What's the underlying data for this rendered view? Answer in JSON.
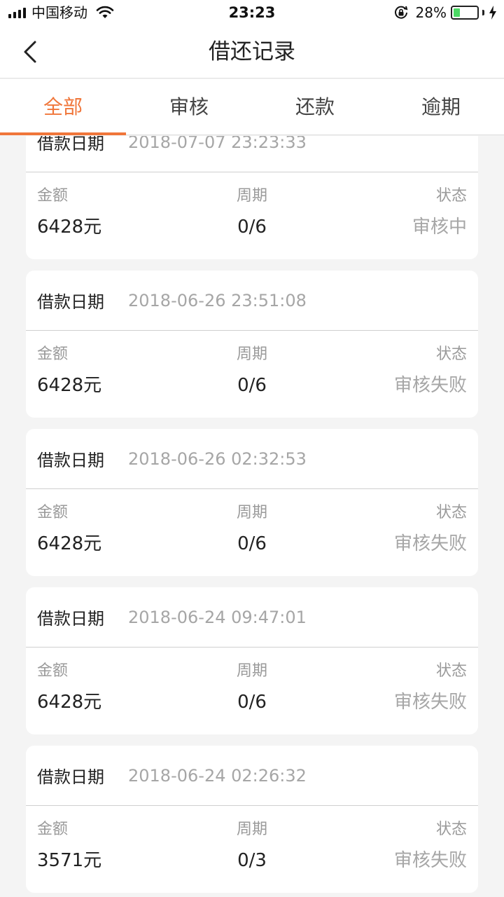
{
  "status_bar": {
    "carrier": "中国移动",
    "time": "23:23",
    "battery_percent": "28%",
    "battery_level": 0.28,
    "colors": {
      "battery_fill": "#4cd964"
    }
  },
  "nav": {
    "title": "借还记录",
    "back_icon": "chevron-left-icon"
  },
  "tabs": [
    {
      "label": "全部",
      "active": true
    },
    {
      "label": "审核",
      "active": false
    },
    {
      "label": "还款",
      "active": false
    },
    {
      "label": "逾期",
      "active": false
    }
  ],
  "accent_color": "#f0763a",
  "labels": {
    "date": "借款日期",
    "amount": "金额",
    "period": "周期",
    "status": "状态"
  },
  "records": [
    {
      "date": "2018-07-07 23:23:33",
      "amount": "6428元",
      "period": "0/6",
      "status": "审核中"
    },
    {
      "date": "2018-06-26 23:51:08",
      "amount": "6428元",
      "period": "0/6",
      "status": "审核失败"
    },
    {
      "date": "2018-06-26 02:32:53",
      "amount": "6428元",
      "period": "0/6",
      "status": "审核失败"
    },
    {
      "date": "2018-06-24 09:47:01",
      "amount": "6428元",
      "period": "0/6",
      "status": "审核失败"
    },
    {
      "date": "2018-06-24 02:26:32",
      "amount": "3571元",
      "period": "0/3",
      "status": "审核失败"
    }
  ]
}
